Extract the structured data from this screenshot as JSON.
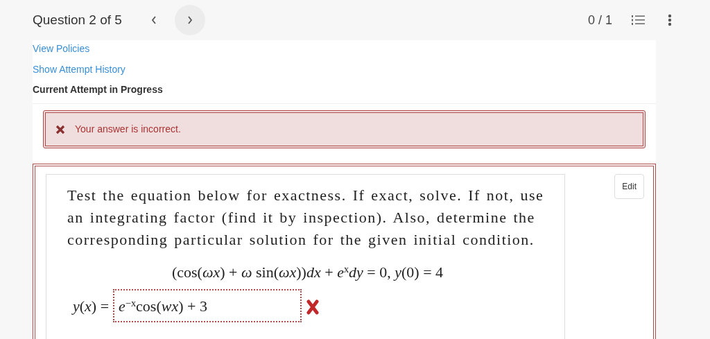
{
  "header": {
    "title": "Question 2 of 5",
    "score": "0 / 1"
  },
  "links": [
    {
      "label": "View Policies"
    },
    {
      "label": "Show Attempt History"
    }
  ],
  "attempt_heading": "Current Attempt in Progress",
  "feedback": {
    "correct": false,
    "message": "Your answer is incorrect."
  },
  "question": {
    "correct": false,
    "edit_button": "Edit",
    "prompt": "Test the equation below for exactness. If exact, solve. If not, use an integrating factor (find it by inspection). Also, determine the corresponding particular solution for the given initial condition.",
    "equation": "(cos(*ωx*) + *ω* sin(*ωx*))*dx* + *e*$^{x}$*dy* = 0, *y*(0) = 4",
    "answer_label": "*y*(*x*) =",
    "answer_value": "*e*$^{−x}$cos(*wx*) + 3",
    "answer_correct": false
  }
}
